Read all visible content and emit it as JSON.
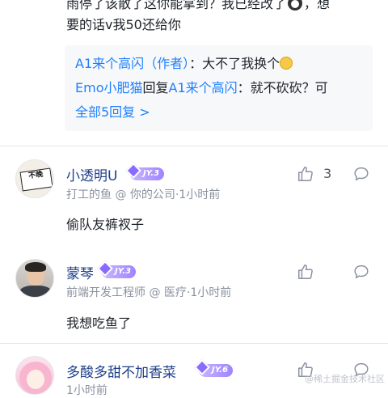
{
  "top_comment": {
    "line1": "雨停了该散了这你能拿到？我已经改了",
    "line1_tail": "，想",
    "line2": "要的话v我50还给你",
    "emoji_icon": "penguin-emoji-icon"
  },
  "replies": [
    {
      "author": "A1来个高闪（作者）",
      "text": "：大不了我换个",
      "emoji_icon": "dizzy-face-emoji-icon"
    },
    {
      "author": "Emo小肥猫",
      "connector": "回复",
      "target": "A1来个高闪",
      "text": "：就不砍砍？可"
    }
  ],
  "show_all_replies": "全部5回复 >",
  "comments": [
    {
      "name": "小透明U",
      "level": "JY.3",
      "meta": "打工的鱼 @ 你的公司·1小时前",
      "text": "偷队友裤衩子",
      "likes": "3",
      "avatar_text": "不晚"
    },
    {
      "name": "蒙琴",
      "level": "JY.3",
      "meta": "前端开发工程师 @ 医疗·1小时前",
      "text": "我想吃鱼了",
      "likes": ""
    },
    {
      "name": "多酸多甜不加香菜",
      "level": "JY.6",
      "meta": "1小时前",
      "text": "",
      "likes": ""
    }
  ],
  "watermark": "@稀土掘金技术社区",
  "colors": {
    "link_blue": "#1e80ff",
    "name_blue": "#1e3f8a",
    "meta_gray": "#8a919f",
    "reply_bg": "#f7f8fa",
    "badge_purple": "#9f83ff"
  }
}
